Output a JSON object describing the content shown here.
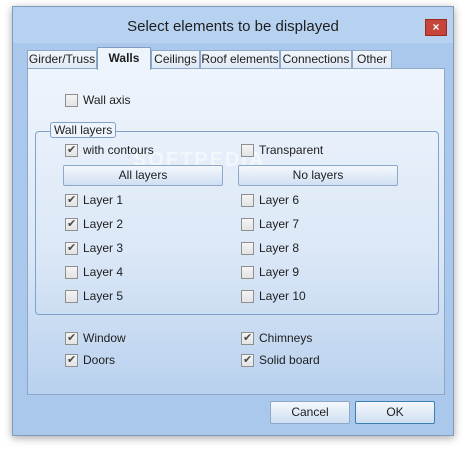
{
  "window": {
    "title": "Select elements to be displayed",
    "close_glyph": "×"
  },
  "tabs": [
    {
      "label": "Girder/Truss",
      "active": false
    },
    {
      "label": "Walls",
      "active": true
    },
    {
      "label": "Ceilings",
      "active": false
    },
    {
      "label": "Roof elements",
      "active": false
    },
    {
      "label": "Connections",
      "active": false
    },
    {
      "label": "Other",
      "active": false
    }
  ],
  "wall_axis": {
    "label": "Wall axis",
    "checked": false
  },
  "wall_layers": {
    "group_label": "Wall layers",
    "with_contours": {
      "label": "with contours",
      "checked": true
    },
    "transparent": {
      "label": "Transparent",
      "checked": false
    },
    "all_layers_label": "All layers",
    "no_layers_label": "No layers",
    "layers": [
      {
        "label": "Layer 1",
        "checked": true
      },
      {
        "label": "Layer 2",
        "checked": true
      },
      {
        "label": "Layer 3",
        "checked": true
      },
      {
        "label": "Layer 4",
        "checked": false
      },
      {
        "label": "Layer 5",
        "checked": false
      },
      {
        "label": "Layer 6",
        "checked": false
      },
      {
        "label": "Layer 7",
        "checked": false
      },
      {
        "label": "Layer 8",
        "checked": false
      },
      {
        "label": "Layer 9",
        "checked": false
      },
      {
        "label": "Layer 10",
        "checked": false
      }
    ]
  },
  "extras": [
    {
      "label": "Window",
      "checked": true
    },
    {
      "label": "Chimneys",
      "checked": true
    },
    {
      "label": "Doors",
      "checked": true
    },
    {
      "label": "Solid board",
      "checked": true
    }
  ],
  "buttons": {
    "cancel_label": "Cancel",
    "ok_label": "OK"
  },
  "watermark": "SOFTPEDIA"
}
